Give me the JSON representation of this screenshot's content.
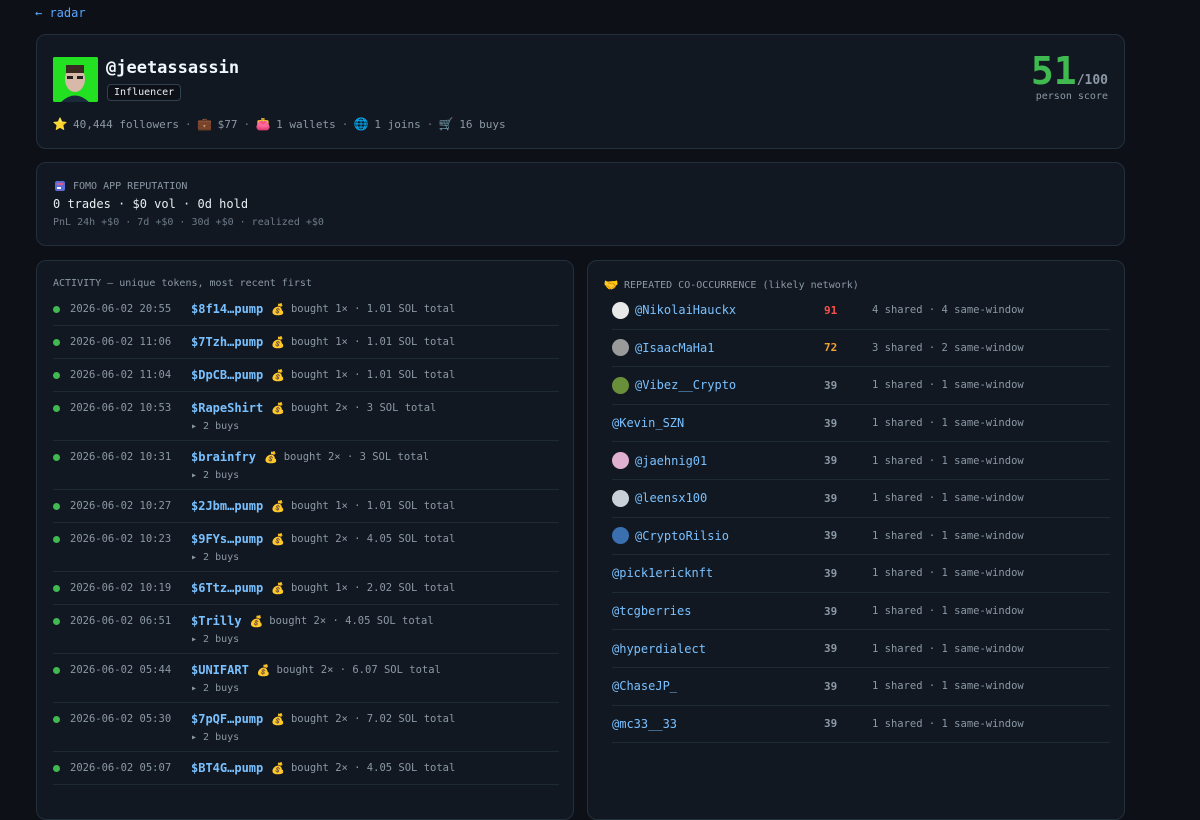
{
  "nav": {
    "back_label": "← radar"
  },
  "profile": {
    "handle": "@jeetassassin",
    "role": "Influencer",
    "score": "51",
    "score_max": "/100",
    "score_label": "person score",
    "score_color": "#3fb950",
    "stats": [
      {
        "icon": "star-icon",
        "glyph": "⭐",
        "text": "40,444 followers"
      },
      {
        "icon": "briefcase-icon",
        "glyph": "💼",
        "text": "$77"
      },
      {
        "icon": "wallet-icon",
        "glyph": "👛",
        "text": "1 wallets"
      },
      {
        "icon": "globe-icon",
        "glyph": "🌐",
        "text": "1 joins"
      },
      {
        "icon": "cart-icon",
        "glyph": "🛒",
        "text": "16 buys"
      }
    ]
  },
  "reputation": {
    "title": "FOMO APP REPUTATION",
    "main": "0 trades · $0 vol · 0d hold",
    "sub": "PnL 24h +$0 · 7d +$0 · 30d +$0 · realized +$0"
  },
  "activity": {
    "title": "ACTIVITY — unique tokens, most recent first",
    "rows": [
      {
        "time": "2026-06-02 20:55",
        "token": "$8f14…pump",
        "desc": "bought 1× · 1.01 SOL total",
        "sub": ""
      },
      {
        "time": "2026-06-02 11:06",
        "token": "$7Tzh…pump",
        "desc": "bought 1× · 1.01 SOL total",
        "sub": ""
      },
      {
        "time": "2026-06-02 11:04",
        "token": "$DpCB…pump",
        "desc": "bought 1× · 1.01 SOL total",
        "sub": ""
      },
      {
        "time": "2026-06-02 10:53",
        "token": "$RapeShirt",
        "desc": "bought 2× · 3 SOL total",
        "sub": "▸ 2 buys"
      },
      {
        "time": "2026-06-02 10:31",
        "token": "$brainfry",
        "desc": "bought 2× · 3 SOL total",
        "sub": "▸ 2 buys"
      },
      {
        "time": "2026-06-02 10:27",
        "token": "$2Jbm…pump",
        "desc": "bought 1× · 1.01 SOL total",
        "sub": ""
      },
      {
        "time": "2026-06-02 10:23",
        "token": "$9FYs…pump",
        "desc": "bought 2× · 4.05 SOL total",
        "sub": "▸ 2 buys"
      },
      {
        "time": "2026-06-02 10:19",
        "token": "$6Ttz…pump",
        "desc": "bought 1× · 2.02 SOL total",
        "sub": ""
      },
      {
        "time": "2026-06-02 06:51",
        "token": "$Trilly",
        "desc": "bought 2× · 4.05 SOL total",
        "sub": "▸ 2 buys"
      },
      {
        "time": "2026-06-02 05:44",
        "token": "$UNIFART",
        "desc": "bought 2× · 6.07 SOL total",
        "sub": "▸ 2 buys"
      },
      {
        "time": "2026-06-02 05:30",
        "token": "$7pQF…pump",
        "desc": "bought 2× · 7.02 SOL total",
        "sub": "▸ 2 buys"
      },
      {
        "time": "2026-06-02 05:07",
        "token": "$BT4G…pump",
        "desc": "bought 2× · 4.05 SOL total",
        "sub": ""
      }
    ]
  },
  "cooccurrence": {
    "title": "REPEATED CO-OCCURRENCE (likely network)",
    "rows": [
      {
        "name": "@NikolaiHauckx",
        "score": "91",
        "level": "hi",
        "meta": "4 shared · 4 same-window",
        "avatar": "#e8e8e8"
      },
      {
        "name": "@IsaacMaHa1",
        "score": "72",
        "level": "mid",
        "meta": "3 shared · 2 same-window",
        "avatar": "#9a9a9a"
      },
      {
        "name": "@Vibez__Crypto",
        "score": "39",
        "level": "",
        "meta": "1 shared · 1 same-window",
        "avatar": "#6a8f3a"
      },
      {
        "name": "@Kevin_SZN",
        "score": "39",
        "level": "",
        "meta": "1 shared · 1 same-window",
        "avatar": ""
      },
      {
        "name": "@jaehnig01",
        "score": "39",
        "level": "",
        "meta": "1 shared · 1 same-window",
        "avatar": "#e0b0d0"
      },
      {
        "name": "@leensx100",
        "score": "39",
        "level": "",
        "meta": "1 shared · 1 same-window",
        "avatar": "#c8d0d8"
      },
      {
        "name": "@CryptoRilsio",
        "score": "39",
        "level": "",
        "meta": "1 shared · 1 same-window",
        "avatar": "#3a6fb0"
      },
      {
        "name": "@pick1ericknft",
        "score": "39",
        "level": "",
        "meta": "1 shared · 1 same-window",
        "avatar": ""
      },
      {
        "name": "@tcgberries",
        "score": "39",
        "level": "",
        "meta": "1 shared · 1 same-window",
        "avatar": ""
      },
      {
        "name": "@hyperdialect",
        "score": "39",
        "level": "",
        "meta": "1 shared · 1 same-window",
        "avatar": ""
      },
      {
        "name": "@ChaseJP_",
        "score": "39",
        "level": "",
        "meta": "1 shared · 1 same-window",
        "avatar": ""
      },
      {
        "name": "@mc33__33",
        "score": "39",
        "level": "",
        "meta": "1 shared · 1 same-window",
        "avatar": ""
      }
    ]
  }
}
